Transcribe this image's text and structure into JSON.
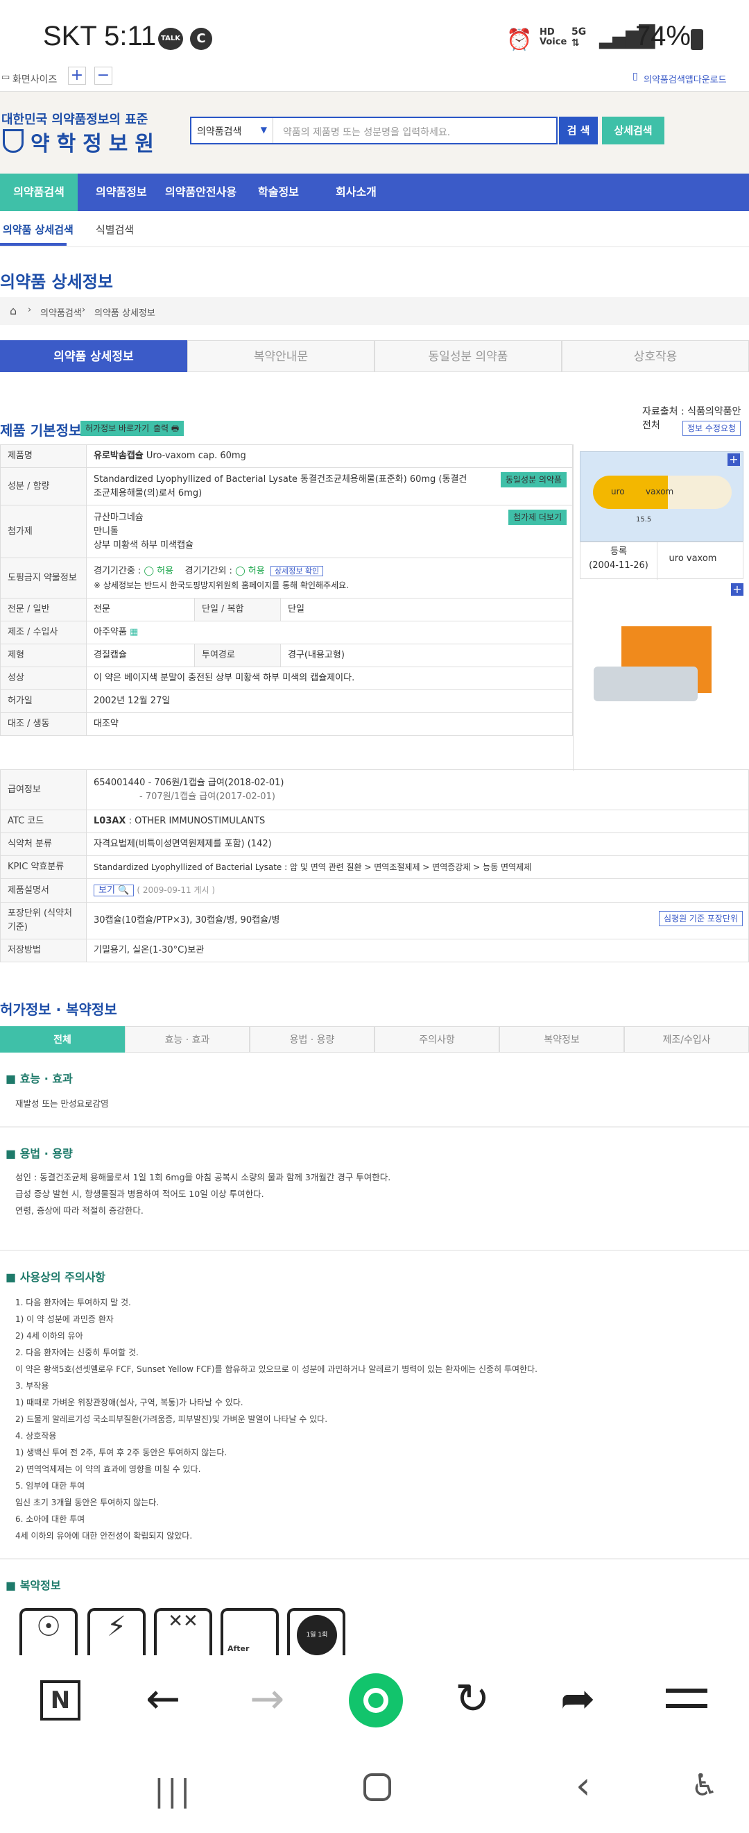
{
  "status": {
    "carrier_time": "SKT 5:11",
    "battery": "74%",
    "icons": [
      "talk-icon",
      "c-icon",
      "alarm-icon",
      "hd-voice-icon",
      "5g-icon",
      "signal-icon",
      "battery-icon"
    ]
  },
  "topline": {
    "desktop": "화면사이즈",
    "download": "의약품검색앱다운로드"
  },
  "header": {
    "sub": "대한민국 의약품정보의 표준",
    "name": "약학정보원",
    "search_select": "의약품검색",
    "search_placeholder": "약품의 제품명 또는 성분명을 입력하세요.",
    "search_btn": "검 색",
    "detail_btn": "상세검색"
  },
  "nav": [
    "의약품검색",
    "의약품정보",
    "의약품안전사용",
    "학술정보",
    "회사소개"
  ],
  "subnav": [
    "의약품 상세검색",
    "식별검색"
  ],
  "page_title": "의약품 상세정보",
  "breadcrumb": [
    "의약품검색",
    "의약품 상세정보"
  ],
  "tabs": [
    "의약품 상세정보",
    "복약안내문",
    "동일성분 의약품",
    "상호작용"
  ],
  "basic": {
    "title": "제품 기본정보",
    "btn_permit": "허가정보 바로가기",
    "btn_print": "출력",
    "source": "자료출처 : 식품의약품안전처",
    "fix_btn": "정보 수정요청"
  },
  "rows": {
    "name_lbl": "제품명",
    "name_val": "유로박솜캡슐",
    "name_en": "Uro-vaxom cap. 60mg",
    "ing_lbl": "성분 / 함량",
    "ing_val": "Standardized Lyophyllized of Bacterial Lysate   동결건조균체용해물(표준화)   60mg (동결건조균체용해물(의)로서 6mg)",
    "ing_btn": "동일성분 의약품",
    "add_lbl": "첨가제",
    "add_1": "규산마그네슘",
    "add_2": "만니톨",
    "add_3": "상부 미황색 하부 미색캡슐",
    "add_btn": "첨가제 더보기",
    "dope_lbl": "도핑금지 약물정보",
    "dope_1": "경기기간중 : ",
    "dope_1v": "허용",
    "dope_2": "경기기간외 : ",
    "dope_2v": "허용",
    "dope_btn": "상세정보 확인",
    "dope_note": "※ 상세정보는 반드시 한국도핑방지위원회 홈페이지를 통해 확인해주세요.",
    "type_lbl": "전문 / 일반",
    "type_val": "전문",
    "combo_lbl": "단일 / 복합",
    "combo_val": "단일",
    "maker_lbl": "제조 / 수입사",
    "maker_val": "아주약품",
    "form_lbl": "제형",
    "form_val": "경질캡슐",
    "route_lbl": "투여경로",
    "route_val": "경구(내용고형)",
    "shape_lbl": "성상",
    "shape_val": "이 약은 베이지색 분말이 충전된 상부 미황색 하부 미색의 캡슐제이다.",
    "date_lbl": "허가일",
    "date_val": "2002년 12월 27일",
    "sub_lbl": "대조 / 생동",
    "sub_val": "대조약",
    "pay_lbl": "급여정보",
    "pay_1": "654001440 - 706원/1캡슐 급여(2018-02-01)",
    "pay_2": "- 707원/1캡슐 급여(2017-02-01)",
    "atc_lbl": "ATC 코드",
    "atc_code": "L03AX",
    "atc_val": " : OTHER IMMUNOSTIMULANTS",
    "cls_lbl": "식약처 분류",
    "cls_val": "자격요법제(비특이성면역원제제를 포함) (142)",
    "kpic_lbl": "KPIC 약효분류",
    "kpic_val": "Standardized Lyophyllized of Bacterial Lysate : 암 및 면역 관련 질환 > 면역조절제제 > 면역증강제 > 능동 면역제제",
    "leaflet_lbl": "제품설명서",
    "leaflet_btn": "보기",
    "leaflet_date": "( 2009-09-11 게시 )",
    "pack_lbl": "포장단위 (식약처 기준)",
    "pack_val": "30캡슐(10캡슐/PTP×3), 30캡슐/병, 90캡슐/병",
    "pack_btn": "심평원 기준 포장단위",
    "store_lbl": "저장방법",
    "store_val": "기밀용기, 실온(1-30°C)보관"
  },
  "image": {
    "reg_lbl": "등록",
    "reg_date": "(2004-11-26)",
    "reg_name": "uro vaxom",
    "cap_left": "uro",
    "cap_right": "vaxom",
    "size": "15.5"
  },
  "permit": {
    "title": "허가정보 · 복약정보",
    "tabs": [
      "전체",
      "효능 · 효과",
      "용법 · 용량",
      "주의사항",
      "복약정보",
      "제조/수입사"
    ]
  },
  "effect": {
    "title": "효능 · 효과",
    "text": "재발성 또는 만성요로감염"
  },
  "dosage": {
    "title": "용법 · 용량",
    "lines": [
      "성인 : 동결건조균체 용해물로서 1일 1회 6mg을 아침 공복시 소량의 물과 함께 3개월간 경구 투여한다.",
      "급성 증상 발현 시, 항생물질과 병용하여 적어도 10일 이상 투여한다.",
      "연령, 증상에 따라 적절히 증감한다."
    ]
  },
  "caution": {
    "title": "사용상의 주의사항",
    "lines": [
      "1. 다음 환자에는 투여하지 말 것.",
      "1) 이 약 성분에 과민증 환자",
      "2) 4세 이하의 유아",
      "2. 다음 환자에는 신중히 투여할 것.",
      "이 약은 황색5호(선셋옐로우 FCF, Sunset Yellow FCF)를 함유하고 있으므로 이 성분에 과민하거나 알레르기 병력이 있는 환자에는 신중히 투여한다.",
      "3. 부작용",
      "1) 때때로 가벼운 위장관장애(설사, 구역, 복통)가 나타날 수 있다.",
      "2) 드물게 알레르기성 국소피부질환(가려움증, 피부발진)및 가벼운 발열이 나타날 수 있다.",
      "4. 상호작용",
      "1) 생백신 투여 전 2주, 투여 후 2주 동안은 투여하지 않는다.",
      "2) 면역억제제는 이 약의 효과에 영향을 미칠 수 있다.",
      "5. 임부에 대한 투여",
      "임신 초기 3개월 동안은 투여하지 않는다.",
      "6. 소아에 대한 투여",
      "4세 이하의 유아에 대한 안전성이 확립되지 않았다."
    ]
  },
  "medinfo": {
    "title": "복약정보",
    "icon_label": "1일 1회",
    "after": "After"
  },
  "browser": {
    "icons": [
      "n-icon",
      "back-icon",
      "forward-icon",
      "home-circle-icon",
      "refresh-icon",
      "share-icon",
      "menu-icon"
    ]
  }
}
